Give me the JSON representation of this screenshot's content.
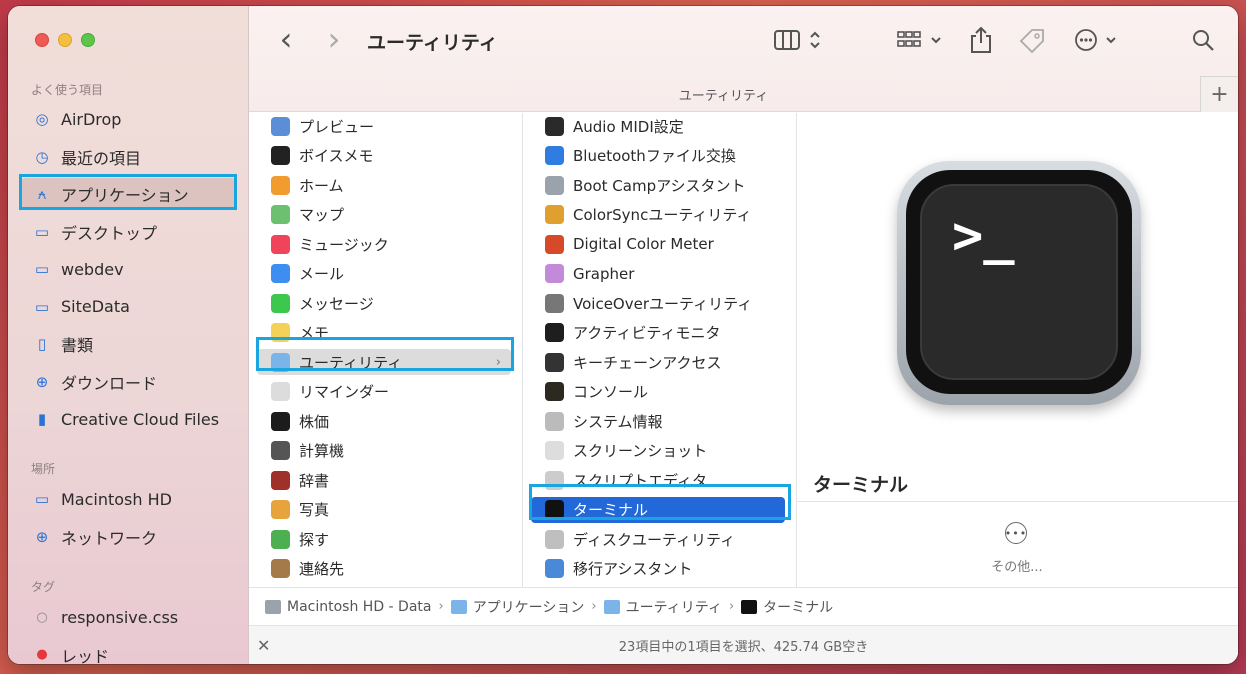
{
  "window": {
    "title": "ユーティリティ"
  },
  "sidebar": {
    "favorites_header": "よく使う項目",
    "favorites": [
      {
        "label": "AirDrop",
        "icon": "airdrop-icon",
        "glyph": "◎"
      },
      {
        "label": "最近の項目",
        "icon": "clock-icon",
        "glyph": "◷"
      },
      {
        "label": "アプリケーション",
        "icon": "applications-icon",
        "glyph": "⍲",
        "selected": true
      },
      {
        "label": "デスクトップ",
        "icon": "desktop-icon",
        "glyph": "▭"
      },
      {
        "label": "webdev",
        "icon": "folder-icon",
        "glyph": "▭"
      },
      {
        "label": "SiteData",
        "icon": "folder-icon",
        "glyph": "▭"
      },
      {
        "label": "書類",
        "icon": "document-icon",
        "glyph": "▯"
      },
      {
        "label": "ダウンロード",
        "icon": "download-icon",
        "glyph": "⊕"
      },
      {
        "label": "Creative Cloud Files",
        "icon": "file-icon",
        "glyph": "▮"
      }
    ],
    "locations_header": "場所",
    "locations": [
      {
        "label": "Macintosh HD",
        "icon": "hard-drive-icon",
        "glyph": "▭"
      },
      {
        "label": "ネットワーク",
        "icon": "network-icon",
        "glyph": "⊕"
      }
    ],
    "tags_header": "タグ",
    "tags": [
      {
        "label": "responsive.css",
        "icon": "tag-empty-icon",
        "glyph": "○",
        "color": "#888888"
      },
      {
        "label": "レッド",
        "icon": "tag-red-icon",
        "glyph": "●",
        "color": "#e5383b"
      }
    ]
  },
  "toolbar": {
    "back": "‹",
    "forward": "›",
    "title": "ユーティリティ",
    "path_title": "ユーティリティ",
    "plus": "+"
  },
  "column1": [
    {
      "label": "プレビュー",
      "icon": "preview-icon",
      "color": "#5b8ed6"
    },
    {
      "label": "ボイスメモ",
      "icon": "voice-memos-icon",
      "color": "#222222"
    },
    {
      "label": "ホーム",
      "icon": "home-icon",
      "color": "#f29b2e"
    },
    {
      "label": "マップ",
      "icon": "maps-icon",
      "color": "#6cc070"
    },
    {
      "label": "ミュージック",
      "icon": "music-icon",
      "color": "#f0445b"
    },
    {
      "label": "メール",
      "icon": "mail-icon",
      "color": "#3d8ef0"
    },
    {
      "label": "メッセージ",
      "icon": "messages-icon",
      "color": "#3cc74e"
    },
    {
      "label": "メモ",
      "icon": "notes-icon",
      "color": "#f4d25a"
    },
    {
      "label": "ユーティリティ",
      "icon": "utilities-folder-icon",
      "color": "#7ab4e8",
      "selected": true
    },
    {
      "label": "リマインダー",
      "icon": "reminders-icon",
      "color": "#dcdcdc"
    },
    {
      "label": "株価",
      "icon": "stocks-icon",
      "color": "#1c1c1c"
    },
    {
      "label": "計算機",
      "icon": "calculator-icon",
      "color": "#555555"
    },
    {
      "label": "辞書",
      "icon": "dictionary-icon",
      "color": "#a0302a"
    },
    {
      "label": "写真",
      "icon": "photos-icon",
      "color": "#e8a43c"
    },
    {
      "label": "探す",
      "icon": "find-my-icon",
      "color": "#4caf50"
    },
    {
      "label": "連絡先",
      "icon": "contacts-icon",
      "color": "#a47a4a"
    }
  ],
  "column2": [
    {
      "label": "Audio MIDI設定",
      "icon": "audio-midi-icon",
      "color": "#2a2a2a"
    },
    {
      "label": "Bluetoothファイル交換",
      "icon": "bluetooth-icon",
      "color": "#2f7de0"
    },
    {
      "label": "Boot Campアシスタント",
      "icon": "bootcamp-icon",
      "color": "#9aa3ab"
    },
    {
      "label": "ColorSyncユーティリティ",
      "icon": "colorsync-icon",
      "color": "#e0a030"
    },
    {
      "label": "Digital Color Meter",
      "icon": "color-meter-icon",
      "color": "#d64a2a"
    },
    {
      "label": "Grapher",
      "icon": "grapher-icon",
      "color": "#c28ad8"
    },
    {
      "label": "VoiceOverユーティリティ",
      "icon": "voiceover-icon",
      "color": "#777777"
    },
    {
      "label": "アクティビティモニタ",
      "icon": "activity-monitor-icon",
      "color": "#1e1e1e"
    },
    {
      "label": "キーチェーンアクセス",
      "icon": "keychain-icon",
      "color": "#333333"
    },
    {
      "label": "コンソール",
      "icon": "console-icon",
      "color": "#2c2a20"
    },
    {
      "label": "システム情報",
      "icon": "system-info-icon",
      "color": "#bbbbbb"
    },
    {
      "label": "スクリーンショット",
      "icon": "screenshot-icon",
      "color": "#dddddd"
    },
    {
      "label": "スクリプトエディタ",
      "icon": "script-editor-icon",
      "color": "#cccccc"
    },
    {
      "label": "ターミナル",
      "icon": "terminal-icon",
      "color": "#111111",
      "selected": true
    },
    {
      "label": "ディスクユーティリティ",
      "icon": "disk-utility-icon",
      "color": "#bfbfbf"
    },
    {
      "label": "移行アシスタント",
      "icon": "migration-icon",
      "color": "#4a89d8"
    }
  ],
  "preview": {
    "prompt": ">_",
    "name": "ターミナル",
    "more_label": "その他..."
  },
  "pathbar": [
    {
      "label": "Macintosh HD - Data",
      "icon": "hard-drive-icon",
      "color": "#9aa3ab"
    },
    {
      "label": "アプリケーション",
      "icon": "applications-folder-icon",
      "color": "#7ab4e8"
    },
    {
      "label": "ユーティリティ",
      "icon": "utilities-folder-icon",
      "color": "#7ab4e8"
    },
    {
      "label": "ターミナル",
      "icon": "terminal-icon",
      "color": "#111111"
    }
  ],
  "status": {
    "text": "23項目中の1項目を選択、425.74 GB空き"
  },
  "colors": {
    "highlight_border": "#18a5e0",
    "selection_blue": "#2268d8",
    "accent_blue": "#2a72d6"
  }
}
